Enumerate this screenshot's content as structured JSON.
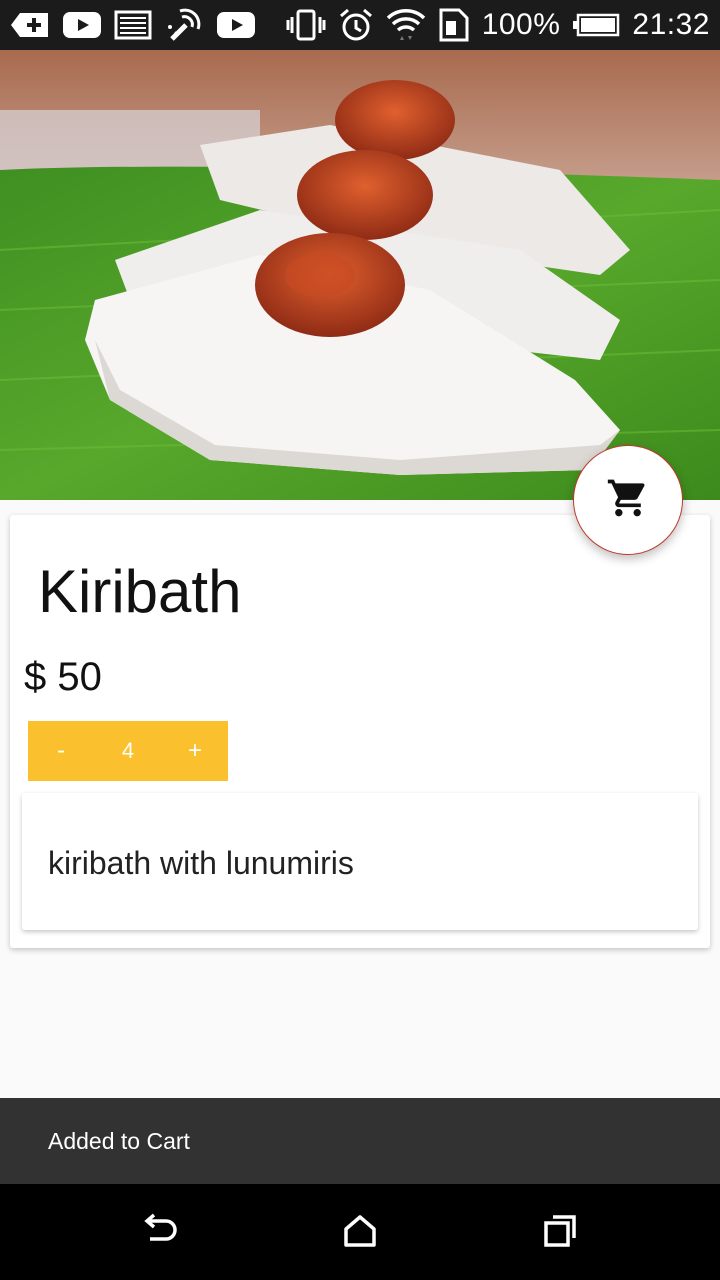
{
  "status_bar": {
    "battery": "100%",
    "time": "21:32",
    "icons": [
      "add-app-icon",
      "youtube-icon",
      "image-icon",
      "magic-wand-icon",
      "youtube-icon",
      "vibrate-icon",
      "alarm-icon",
      "wifi-icon",
      "sim-icon",
      "battery-icon"
    ]
  },
  "product": {
    "image": "kiribath-photo",
    "name": "Kiribath",
    "price": "$ 50",
    "quantity": {
      "minus": "-",
      "value": "4",
      "plus": "+"
    },
    "description": "kiribath with lunumiris"
  },
  "fab": {
    "icon": "cart-icon"
  },
  "snackbar": {
    "message": "Added to Cart"
  },
  "nav": {
    "icons": [
      "back-icon",
      "home-icon",
      "recents-icon"
    ]
  },
  "colors": {
    "accent": "#fbc02d",
    "fab_border": "#c0392b",
    "snackbar": "#323232"
  }
}
